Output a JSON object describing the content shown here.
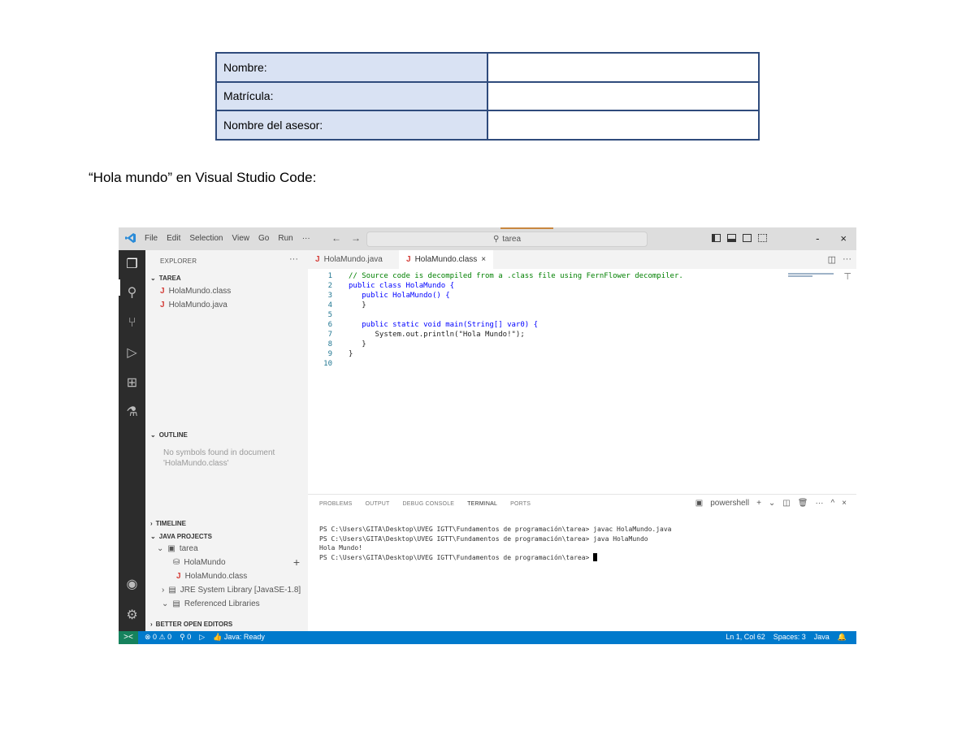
{
  "form": {
    "rows": [
      {
        "label": "Nombre:",
        "value": ""
      },
      {
        "label": "Matrícula:",
        "value": ""
      },
      {
        "label": "Nombre del asesor:",
        "value": ""
      }
    ]
  },
  "caption": "“Hola mundo” en Visual Studio Code:",
  "vscode": {
    "menu": [
      "File",
      "Edit",
      "Selection",
      "View",
      "Go",
      "Run",
      "···"
    ],
    "nav_back": "←",
    "nav_forward": "→",
    "search_text": "tarea",
    "window_controls": {
      "minimize": "-",
      "close": "×"
    },
    "activity_icons": [
      "files-icon",
      "search-icon",
      "source-control-icon",
      "run-debug-icon",
      "extensions-icon",
      "testing-icon",
      "accounts-icon",
      "manage-icon"
    ],
    "sidebar": {
      "title": "EXPLORER",
      "more": "···",
      "tarea_section": "TAREA",
      "files": [
        {
          "icon": "J",
          "name": "HolaMundo.class"
        },
        {
          "icon": "J",
          "name": "HolaMundo.java"
        }
      ],
      "outline_section": "OUTLINE",
      "outline_note": "No symbols found in document 'HolaMundo.class'",
      "timeline_section": "TIMELINE",
      "java_projects_section": "JAVA PROJECTS",
      "project": "tarea",
      "project_items": [
        {
          "name": "HolaMundo"
        },
        {
          "name": "HolaMundo.class"
        },
        {
          "name": "JRE System Library [JavaSE-1.8]"
        },
        {
          "name": "Referenced Libraries"
        }
      ],
      "add_button": "+",
      "better_editors_section": "BETTER OPEN EDITORS"
    },
    "tabs": [
      {
        "icon": "J",
        "label": "HolaMundo.java",
        "active": false
      },
      {
        "icon": "J",
        "label": "HolaMundo.class",
        "active": true,
        "close": "×"
      }
    ],
    "tab_more": "···",
    "code_lines": [
      {
        "n": "1",
        "text": "// Source code is decompiled from a .class file using FernFlower decompiler."
      },
      {
        "n": "2",
        "text": "public class HolaMundo {"
      },
      {
        "n": "3",
        "text": "   public HolaMundo() {"
      },
      {
        "n": "4",
        "text": "   }"
      },
      {
        "n": "5",
        "text": ""
      },
      {
        "n": "6",
        "text": "   public static void main(String[] var0) {"
      },
      {
        "n": "7",
        "text": "      System.out.println(\"Hola Mundo!\");"
      },
      {
        "n": "8",
        "text": "   }"
      },
      {
        "n": "9",
        "text": "}"
      },
      {
        "n": "10",
        "text": ""
      }
    ],
    "panel": {
      "tabs": [
        "PROBLEMS",
        "OUTPUT",
        "DEBUG CONSOLE",
        "TERMINAL",
        "PORTS"
      ],
      "active_tab": "TERMINAL",
      "shell": "powershell",
      "actions": [
        "+",
        "⌄",
        "split",
        "trash",
        "···",
        "^",
        "×"
      ],
      "terminal_lines": [
        "PS C:\\Users\\GITA\\Desktop\\UVEG IGTT\\Fundamentos de programación\\tarea> javac HolaMundo.java",
        "PS C:\\Users\\GITA\\Desktop\\UVEG IGTT\\Fundamentos de programación\\tarea> java HolaMundo",
        "Hola Mundo!",
        "PS C:\\Users\\GITA\\Desktop\\UVEG IGTT\\Fundamentos de programación\\tarea> "
      ]
    },
    "status": {
      "remote": "><",
      "problems": "⊗ 0 ⚠ 0",
      "ports": "0",
      "java": "Java: Ready",
      "position": "Ln 1, Col 62",
      "spaces": "Spaces: 3",
      "language": "Java"
    },
    "colors": {
      "statusbar": "#007acc",
      "activitybar": "#2c2c2c",
      "sidebar": "#f3f3f3",
      "table_label_bg": "#d9e2f3",
      "table_border": "#2f4b7c"
    }
  }
}
